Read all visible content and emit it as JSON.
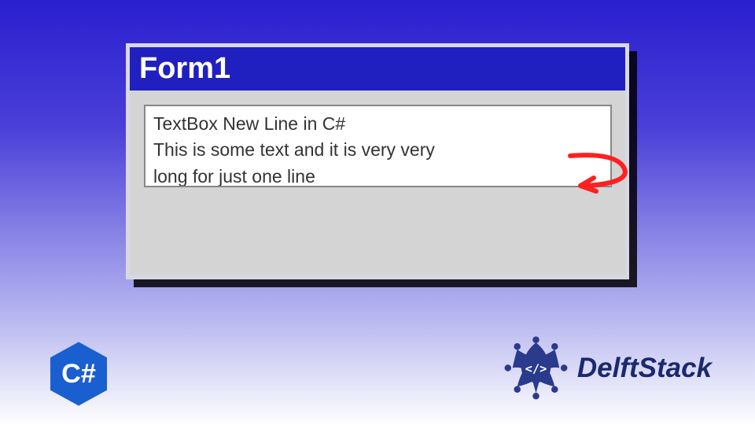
{
  "window": {
    "title": "Form1"
  },
  "textbox": {
    "line1": "TextBox New Line in C#",
    "line2": "This is some text and it is very very",
    "line3": "long for just one line"
  },
  "badges": {
    "csharp_label": "C#",
    "brand_name": "DelftStack"
  },
  "colors": {
    "titlebar_bg": "#2020c0",
    "form_bg": "#d4d4d4",
    "arrow": "#ff2020",
    "badge_bg": "#1a5fd0",
    "brand_text": "#1a2a6c"
  }
}
